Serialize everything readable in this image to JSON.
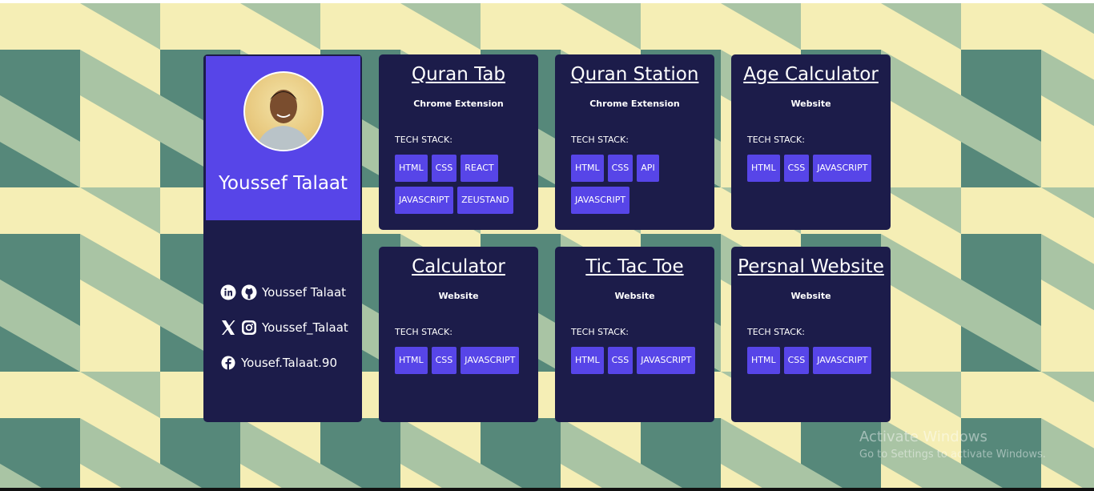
{
  "profile": {
    "name": "Youssef Talaat",
    "social": [
      {
        "label": "Youssef Talaat",
        "icons": [
          "linkedin-icon",
          "github-icon"
        ]
      },
      {
        "label": "Youssef_Talaat",
        "icons": [
          "x-icon",
          "instagram-icon"
        ]
      },
      {
        "label": "Yousef.Talaat.90",
        "icons": [
          "facebook-icon"
        ]
      }
    ]
  },
  "stack_label": "TECH STACK:",
  "projects": [
    {
      "title": "Quran Tab",
      "type": "Chrome Extension",
      "stack": [
        "HTML",
        "CSS",
        "REACT",
        "JAVASCRIPT",
        "ZEUSTAND"
      ]
    },
    {
      "title": "Quran Station",
      "type": "Chrome Extension",
      "stack": [
        "HTML",
        "CSS",
        "API",
        "JAVASCRIPT"
      ]
    },
    {
      "title": "Age Calculator",
      "type": "Website",
      "stack": [
        "HTML",
        "CSS",
        "JAVASCRIPT"
      ]
    },
    {
      "title": "Calculator",
      "type": "Website",
      "stack": [
        "HTML",
        "CSS",
        "JAVASCRIPT"
      ]
    },
    {
      "title": "Tic Tac Toe",
      "type": "Website",
      "stack": [
        "HTML",
        "CSS",
        "JAVASCRIPT"
      ]
    },
    {
      "title": "Persnal Website",
      "type": "Website",
      "stack": [
        "HTML",
        "CSS",
        "JAVASCRIPT"
      ]
    }
  ],
  "watermark": {
    "line1": "Activate Windows",
    "line2": "Go to Settings to activate Windows."
  },
  "colors": {
    "card_bg": "#1c1c4a",
    "accent": "#5745e8",
    "bg_light": "#f5eeb5",
    "bg_mid": "#a9c4a4",
    "bg_dark": "#56887a"
  }
}
